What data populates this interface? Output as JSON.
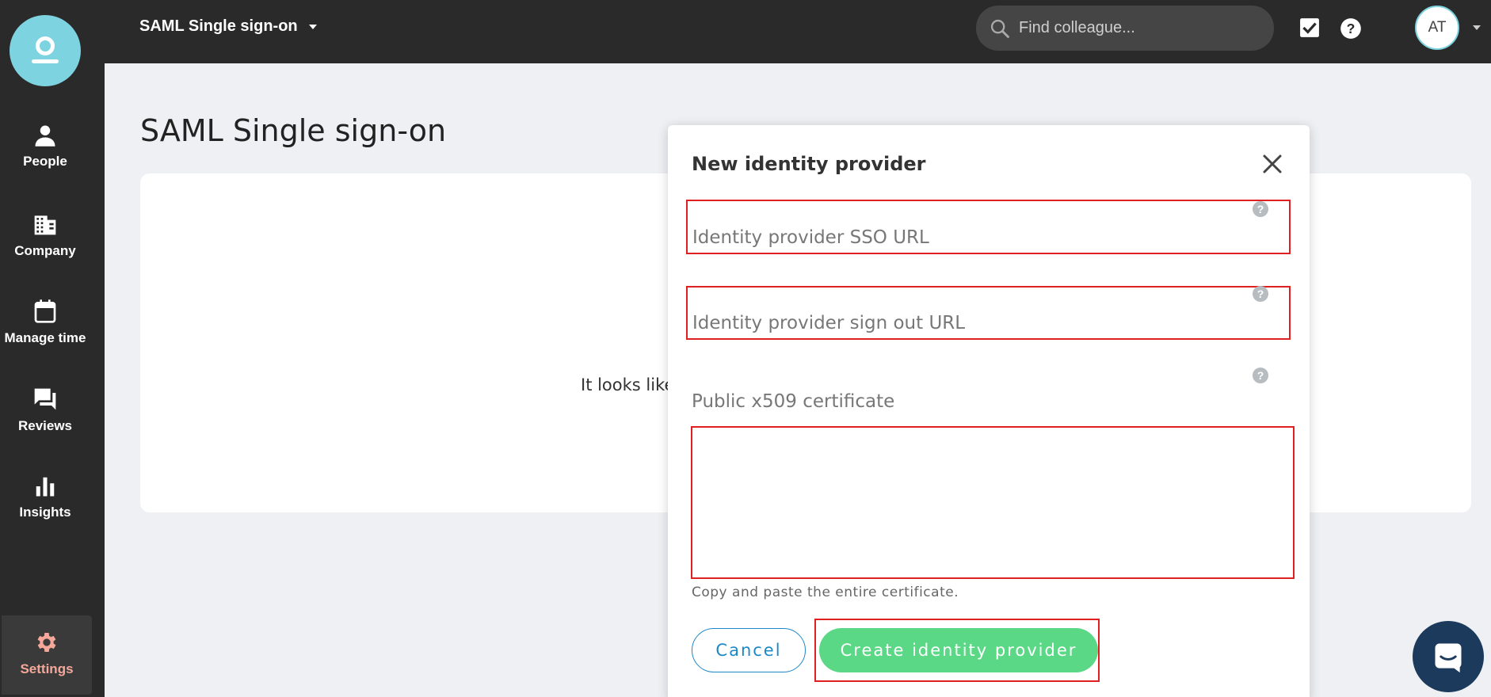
{
  "topbar": {
    "breadcrumb": "SAML Single sign-on",
    "search_placeholder": "Find colleague...",
    "avatar_initials": "AT"
  },
  "sidebar": {
    "items": [
      {
        "label": "People",
        "icon": "person-icon"
      },
      {
        "label": "Company",
        "icon": "building-icon"
      },
      {
        "label": "Manage time",
        "icon": "calendar-icon"
      },
      {
        "label": "Reviews",
        "icon": "chat-icon"
      },
      {
        "label": "Insights",
        "icon": "bar-chart-icon"
      }
    ],
    "settings_label": "Settings"
  },
  "main": {
    "title": "SAML Single sign-on",
    "empty_text": "It looks like"
  },
  "modal": {
    "title": "New identity provider",
    "sso_url_placeholder": "Identity provider SSO URL",
    "sign_out_url_placeholder": "Identity provider sign out URL",
    "cert_label": "Public x509 certificate",
    "cert_hint": "Copy and paste the entire certificate.",
    "cancel_label": "Cancel",
    "create_label": "Create identity provider"
  },
  "colors": {
    "sidebar_bg": "#2a2a2a",
    "accent_teal": "#7dd3df",
    "primary_green": "#5bd886",
    "link_blue": "#1e88c7",
    "highlight_red": "#e02020",
    "settings_active": "#f5a89a"
  }
}
